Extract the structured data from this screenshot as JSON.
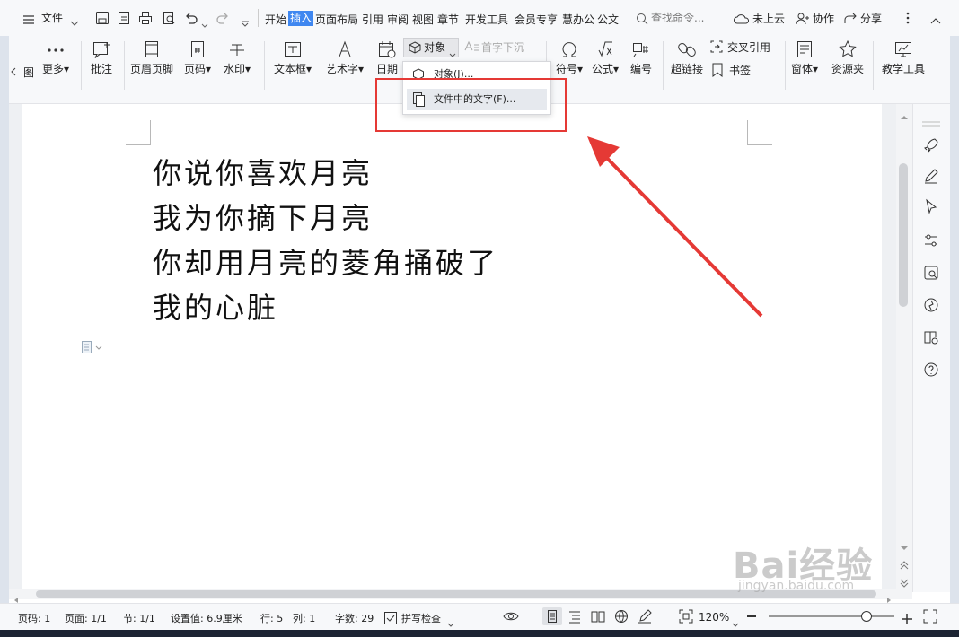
{
  "menubar": {
    "file_label": "文件",
    "tabs": [
      "开始",
      "插入",
      "页面布局",
      "引用",
      "审阅",
      "视图",
      "章节",
      "开发工具",
      "会员专享",
      "慧办公",
      "公文"
    ],
    "active_tab": "插入",
    "search_placeholder": "查找命令...",
    "cloud_label": "未上云",
    "collab_label": "协作",
    "share_label": "分享"
  },
  "ribbon": {
    "partial_label": "图",
    "more_label": "更多",
    "comment_label": "批注",
    "header_footer_label": "页眉页脚",
    "page_num_label": "页码",
    "watermark_label": "水印",
    "textbox_label": "文本框",
    "wordart_label": "艺术字",
    "date_label": "日期",
    "object_label": "对象",
    "dropcap_label": "首字下沉",
    "symbol_label": "符号",
    "formula_label": "公式",
    "numbering_label": "编号",
    "hyperlink_label": "超链接",
    "crossref_label": "交叉引用",
    "bookmark_label": "书签",
    "window_label": "窗体",
    "resource_label": "资源夹",
    "teaching_label": "教学工具"
  },
  "dropdown": {
    "items": [
      "对象(J)...",
      "文件中的文字(F)..."
    ]
  },
  "document": {
    "lines": [
      "你说你喜欢月亮",
      "我为你摘下月亮",
      "你却用月亮的菱角捅破了",
      "我的心脏"
    ]
  },
  "statusbar": {
    "page_num": "页码: 1",
    "pages": "页面: 1/1",
    "section": "节: 1/1",
    "setting": "设置值: 6.9厘米",
    "row": "行: 5",
    "col": "列: 1",
    "word_count": "字数: 29",
    "spellcheck": "拼写检查",
    "zoom": "120%",
    "zoom_fraction": 0.78
  },
  "watermark": {
    "brand": "Bai经验",
    "url": "jingyan.baidu.com"
  },
  "colors": {
    "accent": "#3f87f0",
    "highlight": "#e53935"
  }
}
